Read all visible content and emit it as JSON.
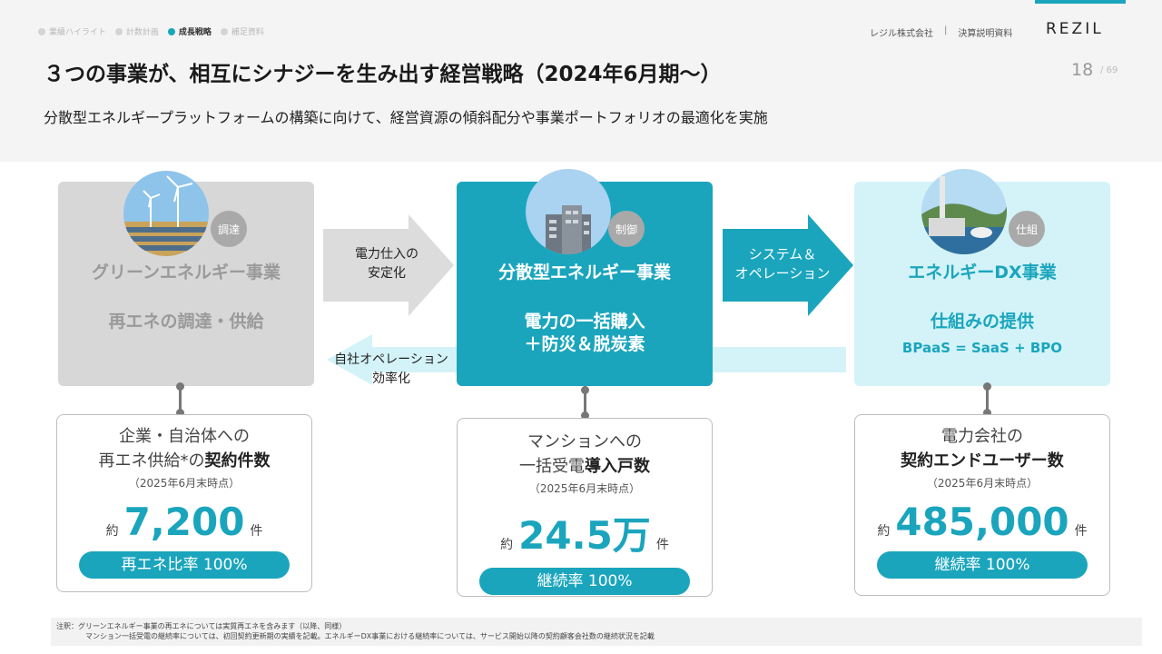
{
  "header": {
    "nav": [
      {
        "label": "業績ハイライト",
        "active": false
      },
      {
        "label": "計数計画",
        "active": false
      },
      {
        "label": "成長戦略",
        "active": true
      },
      {
        "label": "補足資料",
        "active": false
      }
    ],
    "company": "レジル株式会社",
    "doc_type": "決算説明資料",
    "logo": "REZIL",
    "title": "３つの事業が、相互にシナジーを生み出す経営戦略（2024年6月期〜）",
    "subtitle": "分散型エネルギープラットフォームの構築に向けて、経営資源の傾斜配分や事業ポートフォリオの最適化を実施",
    "page": "18",
    "page_total": "69"
  },
  "businesses": {
    "green": {
      "badge": "調達",
      "title": "グリーンエネルギー事業",
      "sub": "再エネの調達・供給",
      "photo": "wind-turbine-solar-icon"
    },
    "distributed": {
      "badge": "制御",
      "title": "分散型エネルギー事業",
      "sub_line1": "電力の一括購入",
      "sub_line2": "＋防災＆脱炭素",
      "photo": "apartment-building-icon"
    },
    "dx": {
      "badge": "仕組",
      "title": "エネルギーDX事業",
      "sub": "仕組みの提供",
      "sub2": "BPaaS = SaaS + BPO",
      "photo": "power-plant-icon"
    }
  },
  "arrows": {
    "green_to_dist_line1": "電力仕入の",
    "green_to_dist_line2": "安定化",
    "dist_to_dx_line1": "システム＆",
    "dist_to_dx_line2": "オペレーション",
    "dx_to_dist_line1": "自社オペレーション",
    "dx_to_dist_line2": "効率化"
  },
  "stats": {
    "green": {
      "line1": "企業・自治体への",
      "line2_plain": "再エネ供給*の",
      "line2_bold": "契約件数",
      "date": "（2025年6月末時点）",
      "approx": "約",
      "value": "7,200",
      "unit": "件",
      "pill": "再エネ比率 100%"
    },
    "distributed": {
      "line1": "マンションへの",
      "line2_plain": "一括受電",
      "line2_bold": "導入戸数",
      "date": "（2025年6月末時点）",
      "approx": "約",
      "value": "24.5万",
      "unit": "件",
      "pill": "継続率 100%"
    },
    "dx": {
      "line1": "電力会社の",
      "line2_plain": "",
      "line2_bold": "契約エンドユーザー数",
      "date": "（2025年6月末時点）",
      "approx": "約",
      "value": "485,000",
      "unit": "件",
      "pill": "継続率 100%"
    }
  },
  "note": {
    "line1": "注釈：グリーンエネルギー事業の再エネについては実質再エネを含みます（以降、同様）",
    "line2": "マンション一括受電の継続率については、初回契約更新期の実績を記載。エネルギーDX事業における継続率については、サービス開始以降の契約顧客会社数の継続状況を記載"
  },
  "colors": {
    "accent": "#1aa5bd",
    "light_accent": "#d3f3f8",
    "gray_card": "#d7d7d7"
  }
}
